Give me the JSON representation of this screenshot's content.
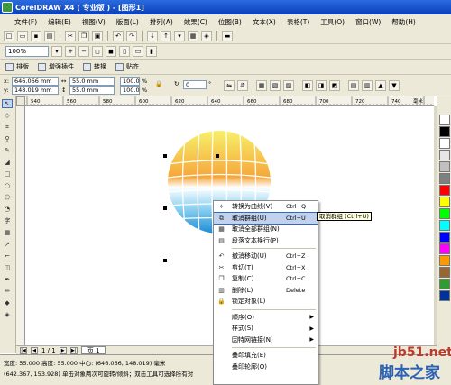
{
  "window": {
    "title": "CorelDRAW X4 ( 专业版 ) - [图形1]"
  },
  "menubar": [
    "文件(F)",
    "编辑(E)",
    "视图(V)",
    "版面(L)",
    "排列(A)",
    "效果(C)",
    "位图(B)",
    "文本(X)",
    "表格(T)",
    "工具(O)",
    "窗口(W)",
    "帮助(H)"
  ],
  "zoom": {
    "value": "100%"
  },
  "plugins": [
    "排版",
    "增强插件",
    "转换",
    "贴齐"
  ],
  "properties": {
    "x": "646.066 mm",
    "y": "148.019 mm",
    "width": "55.0 mm",
    "height": "55.0 mm",
    "scale_x": "100.0",
    "scale_y": "100.0",
    "percent": "%",
    "rotation": "0",
    "rotation_unit": "°",
    "x_label": "x:",
    "y_label": "y:"
  },
  "ruler": {
    "ticks": [
      "540",
      "560",
      "580",
      "600",
      "620",
      "640",
      "660",
      "680",
      "700",
      "720",
      "740"
    ],
    "unit": "毫米"
  },
  "context_menu": {
    "items": [
      {
        "label": "转换为曲线(V)",
        "shortcut": "Ctrl+Q",
        "icon": "convert-curve-icon"
      },
      {
        "label": "取消群组(U)",
        "shortcut": "Ctrl+U",
        "icon": "ungroup-icon",
        "highlighted": true
      },
      {
        "label": "取消全部群组(N)",
        "shortcut": "",
        "icon": "ungroup-all-icon"
      },
      {
        "label": "段落文本换行(P)",
        "shortcut": "",
        "icon": "text-wrap-icon"
      },
      {
        "separator": true
      },
      {
        "label": "撤消移动(U)",
        "shortcut": "Ctrl+Z",
        "icon": "undo-icon"
      },
      {
        "label": "剪切(T)",
        "shortcut": "Ctrl+X",
        "icon": "cut-icon"
      },
      {
        "label": "复制(C)",
        "shortcut": "Ctrl+C",
        "icon": "copy-icon"
      },
      {
        "label": "删除(L)",
        "shortcut": "Delete",
        "icon": "delete-icon"
      },
      {
        "label": "锁定对象(L)",
        "shortcut": "",
        "icon": "lock-icon"
      },
      {
        "separator": true
      },
      {
        "label": "顺序(O)",
        "submenu": true
      },
      {
        "label": "样式(S)",
        "submenu": true
      },
      {
        "label": "因特网链接(N)",
        "submenu": true
      },
      {
        "separator": true
      },
      {
        "label": "叠印填充(E)"
      },
      {
        "label": "叠印轮廓(O)"
      }
    ]
  },
  "tooltip": "取消群组 (Ctrl+U)",
  "page_nav": {
    "page_count": "1 / 1",
    "page_tab": "页 1"
  },
  "status": {
    "line1": "宽度: 55.000 高度: 55.000 中心: (646.066, 148.019) 毫米",
    "line2": "(642.367, 153.928)   单击对象两次可旋转/倾斜；双击工具可选择所有对"
  },
  "palette": [
    "#ffffff",
    "#000000",
    "#ffffff",
    "#e6e6e6",
    "#c0c0c0",
    "#808080",
    "#ff0000",
    "#ffff00",
    "#00ff00",
    "#00ffff",
    "#0000ff",
    "#ff00ff",
    "#ff9900",
    "#996633",
    "#339933",
    "#003399"
  ],
  "watermark": {
    "site": "jb51.net",
    "name": "脚本之家"
  }
}
